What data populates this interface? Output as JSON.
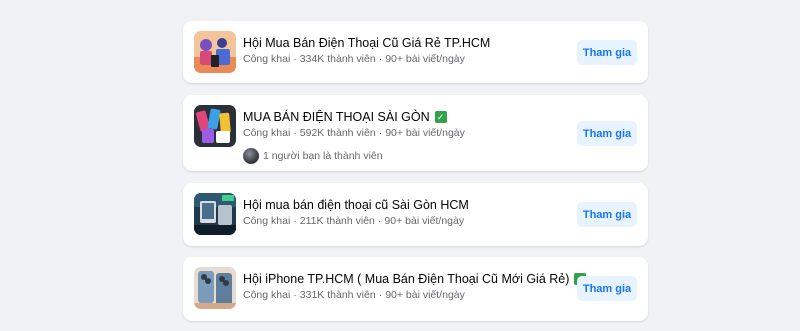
{
  "groups": [
    {
      "name": "Hội Mua Bán Điện Thoại Cũ Giá Rẻ TP.HCM",
      "privacy": "Công khai",
      "members": "334K thành viên",
      "posts": "90+ bài viết/ngày",
      "verified": false,
      "join_label": "Tham gia"
    },
    {
      "name": "MUA BÁN ĐIỆN THOẠI SÀI GÒN",
      "privacy": "Công khai",
      "members": "592K thành viên",
      "posts": "90+ bài viết/ngày",
      "verified": true,
      "friends_text": "1 người bạn là thành viên",
      "join_label": "Tham gia"
    },
    {
      "name": "Hội mua bán điện thoại cũ Sài Gòn HCM",
      "privacy": "Công khai",
      "members": "211K thành viên",
      "posts": "90+ bài viết/ngày",
      "verified": false,
      "join_label": "Tham gia"
    },
    {
      "name": "Hội iPhone TP.HCM ( Mua Bán Điện Thoại Cũ Mới Giá Rẻ)",
      "privacy": "Công khai",
      "members": "331K thành viên",
      "posts": "90+ bài viết/ngày",
      "verified": true,
      "join_label": "Tham gia"
    }
  ],
  "separator": "·",
  "verified_icon": "✓",
  "colors": {
    "page_bg": "#f0f2f5",
    "button_bg": "#e7f3ff",
    "button_text": "#1877f2",
    "verified": "#31a24c"
  }
}
